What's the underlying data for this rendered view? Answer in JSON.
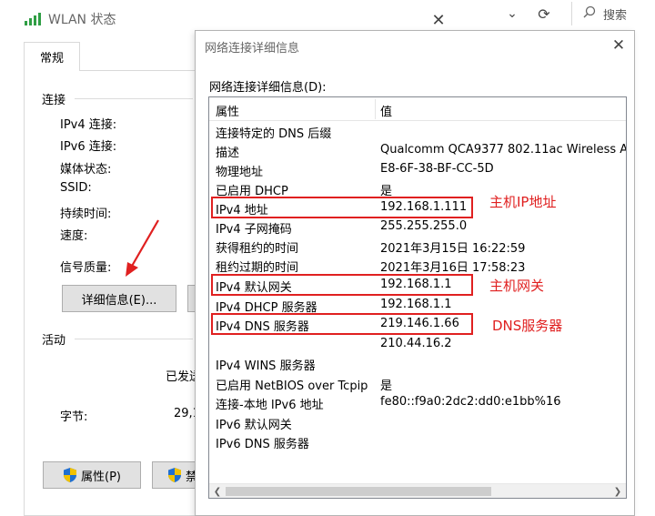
{
  "background_window": {
    "search_placeholder": "搜索"
  },
  "wlan_window": {
    "title": "WLAN 状态",
    "tab": "常规",
    "connection_group": "连接",
    "fields": [
      {
        "label": "IPv4 连接:"
      },
      {
        "label": "IPv6 连接:"
      },
      {
        "label": "媒体状态:"
      },
      {
        "label": "SSID:"
      },
      {
        "label": "持续时间:"
      },
      {
        "label": "速度:"
      }
    ],
    "signal_label": "信号质量:",
    "details_button": "详细信息(E)...",
    "activity_group": "活动",
    "sent_label": "已发送",
    "bytes_label": "字节:",
    "bytes_value": "29,1",
    "properties_button": "属性(P)",
    "disable_button": "禁"
  },
  "detail_dialog": {
    "title": "网络连接详细信息",
    "list_label": "网络连接详细信息(D):",
    "header_property": "属性",
    "header_value": "值",
    "rows": [
      {
        "property": "连接特定的 DNS 后缀",
        "value": ""
      },
      {
        "property": "描述",
        "value": "Qualcomm QCA9377 802.11ac Wireless A"
      },
      {
        "property": "物理地址",
        "value": "E8-6F-38-BF-CC-5D"
      },
      {
        "property": "已启用 DHCP",
        "value": "是"
      },
      {
        "property": "IPv4 地址",
        "value": "192.168.1.111"
      },
      {
        "property": "IPv4 子网掩码",
        "value": "255.255.255.0"
      },
      {
        "property": "获得租约的时间",
        "value": "2021年3月15日 16:22:59"
      },
      {
        "property": "租约过期的时间",
        "value": "2021年3月16日 17:58:23"
      },
      {
        "property": "IPv4 默认网关",
        "value": "192.168.1.1"
      },
      {
        "property": "IPv4 DHCP 服务器",
        "value": "192.168.1.1"
      },
      {
        "property": "IPv4 DNS 服务器",
        "value": "219.146.1.66"
      },
      {
        "property": "",
        "value": "210.44.16.2"
      },
      {
        "property": "IPv4 WINS 服务器",
        "value": ""
      },
      {
        "property": "已启用 NetBIOS over Tcpip",
        "value": "是"
      },
      {
        "property": "连接-本地 IPv6 地址",
        "value": "fe80::f9a0:2dc2:dd0:e1bb%16"
      },
      {
        "property": "IPv6 默认网关",
        "value": ""
      },
      {
        "property": "IPv6 DNS 服务器",
        "value": ""
      }
    ]
  },
  "annotations": {
    "ip_label": "主机IP地址",
    "gateway_label": "主机网关",
    "dns_label": "DNS服务器",
    "color": "#e02020"
  },
  "colors": {
    "signal_green": "#2f9e44",
    "shield_blue": "#1f6fd1",
    "shield_yellow": "#f2c200"
  }
}
